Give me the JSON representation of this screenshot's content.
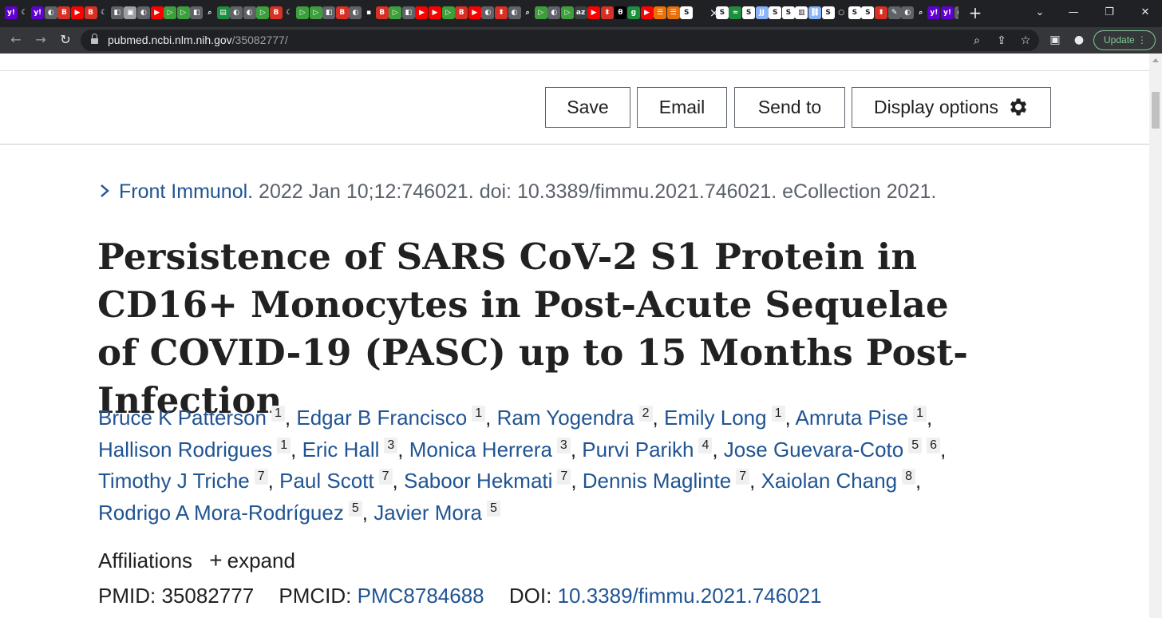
{
  "browser": {
    "url_host": "pubmed.ncbi.nlm.nih.gov",
    "url_path": "/35082777/",
    "update_label": "Update",
    "tab_close": "×",
    "new_tab": "+",
    "tab_favicons": [
      {
        "icon": "yahoo-icon",
        "color": "#6001d2",
        "glyph": "y!"
      },
      {
        "icon": "crescent-icon",
        "color": "#202124",
        "glyph": "☾"
      },
      {
        "icon": "yahoo-icon",
        "color": "#6001d2",
        "glyph": "y!"
      },
      {
        "icon": "globe-icon",
        "color": "#5f6368",
        "glyph": "◐"
      },
      {
        "icon": "bitchute-icon",
        "color": "#d93025",
        "glyph": "B"
      },
      {
        "icon": "youtube-icon",
        "color": "#ff0000",
        "glyph": "▶"
      },
      {
        "icon": "bitchute-icon",
        "color": "#d93025",
        "glyph": "B"
      },
      {
        "icon": "crescent-icon",
        "color": "#202124",
        "glyph": "☾"
      },
      {
        "icon": "doc-icon",
        "color": "#5f6368",
        "glyph": "◧"
      },
      {
        "icon": "image-icon",
        "color": "#9aa0a6",
        "glyph": "▣"
      },
      {
        "icon": "globe-icon",
        "color": "#5f6368",
        "glyph": "◐"
      },
      {
        "icon": "youtube-icon",
        "color": "#ff0000",
        "glyph": "▶"
      },
      {
        "icon": "rumble-icon",
        "color": "#3c9f3c",
        "glyph": "▷"
      },
      {
        "icon": "rumble-icon",
        "color": "#3c9f3c",
        "glyph": "▷"
      },
      {
        "icon": "doc-icon",
        "color": "#5f6368",
        "glyph": "◧"
      },
      {
        "icon": "search-icon",
        "color": "#202124",
        "glyph": "⌕"
      },
      {
        "icon": "notes-icon",
        "color": "#1e8e3e",
        "glyph": "▤"
      },
      {
        "icon": "globe-icon",
        "color": "#5f6368",
        "glyph": "◐"
      },
      {
        "icon": "globe-icon",
        "color": "#5f6368",
        "glyph": "◐"
      },
      {
        "icon": "rumble-icon",
        "color": "#3c9f3c",
        "glyph": "▷"
      },
      {
        "icon": "bitchute-icon",
        "color": "#d93025",
        "glyph": "B"
      },
      {
        "icon": "crescent-icon",
        "color": "#202124",
        "glyph": "☾"
      },
      {
        "icon": "rumble-icon",
        "color": "#3c9f3c",
        "glyph": "▷"
      },
      {
        "icon": "rumble-icon",
        "color": "#3c9f3c",
        "glyph": "▷"
      },
      {
        "icon": "doc-icon",
        "color": "#5f6368",
        "glyph": "◧"
      },
      {
        "icon": "bitchute-icon",
        "color": "#d93025",
        "glyph": "B"
      },
      {
        "icon": "globe-icon",
        "color": "#5f6368",
        "glyph": "◐"
      },
      {
        "icon": "doc-icon",
        "color": "#202124",
        "glyph": "▪"
      },
      {
        "icon": "bitchute-icon",
        "color": "#d93025",
        "glyph": "B"
      },
      {
        "icon": "rumble-icon",
        "color": "#3c9f3c",
        "glyph": "▷"
      },
      {
        "icon": "doc-icon",
        "color": "#5f6368",
        "glyph": "◧"
      },
      {
        "icon": "youtube-icon",
        "color": "#ff0000",
        "glyph": "▶"
      },
      {
        "icon": "youtube-icon",
        "color": "#ff0000",
        "glyph": "▶"
      },
      {
        "icon": "rumble-icon",
        "color": "#3c9f3c",
        "glyph": "▷"
      },
      {
        "icon": "bitchute-icon",
        "color": "#d93025",
        "glyph": "B"
      },
      {
        "icon": "youtube-icon",
        "color": "#ff0000",
        "glyph": "▶"
      },
      {
        "icon": "globe-icon",
        "color": "#5f6368",
        "glyph": "◐"
      },
      {
        "icon": "alert-icon",
        "color": "#d93025",
        "glyph": "⬍"
      },
      {
        "icon": "globe-icon",
        "color": "#5f6368",
        "glyph": "◐"
      },
      {
        "icon": "search-icon",
        "color": "#202124",
        "glyph": "⌕"
      },
      {
        "icon": "rumble-icon",
        "color": "#3c9f3c",
        "glyph": "▷"
      },
      {
        "icon": "globe-icon",
        "color": "#5f6368",
        "glyph": "◐"
      },
      {
        "icon": "rumble-icon",
        "color": "#3c9f3c",
        "glyph": "▷"
      },
      {
        "icon": "text-icon",
        "color": "#3c4043",
        "glyph": "az"
      },
      {
        "icon": "youtube-icon",
        "color": "#ff0000",
        "glyph": "▶"
      },
      {
        "icon": "alert-icon",
        "color": "#d93025",
        "glyph": "⬍"
      },
      {
        "icon": "dark-icon",
        "color": "#000000",
        "glyph": "θ"
      },
      {
        "icon": "g-icon",
        "color": "#1e8e3e",
        "glyph": "g"
      },
      {
        "icon": "youtube-icon",
        "color": "#ff0000",
        "glyph": "▶"
      },
      {
        "icon": "stack-icon",
        "color": "#e8710a",
        "glyph": "☰"
      },
      {
        "icon": "stack-icon",
        "color": "#e8710a",
        "glyph": "☰"
      },
      {
        "icon": "substack-icon",
        "color": "#ffffff",
        "glyph": "S"
      }
    ],
    "tab_favicons_after": [
      {
        "icon": "substack-icon",
        "color": "#ffffff",
        "glyph": "S"
      },
      {
        "icon": "trend-icon",
        "color": "#1e8e3e",
        "glyph": "≈"
      },
      {
        "icon": "substack-icon",
        "color": "#ffffff",
        "glyph": "S"
      },
      {
        "icon": "doc-icon",
        "color": "#8ab4f8",
        "glyph": "JJ"
      },
      {
        "icon": "substack-icon",
        "color": "#ffffff",
        "glyph": "S"
      },
      {
        "icon": "substack-icon",
        "color": "#ffffff",
        "glyph": "S"
      },
      {
        "icon": "doc-icon",
        "color": "#ffffff",
        "glyph": "▥"
      },
      {
        "icon": "link-icon",
        "color": "#8ab4f8",
        "glyph": "⛓"
      },
      {
        "icon": "substack-icon",
        "color": "#ffffff",
        "glyph": "S"
      },
      {
        "icon": "circle-icon",
        "color": "#202124",
        "glyph": "○"
      },
      {
        "icon": "substack-icon",
        "color": "#ffffff",
        "glyph": "S"
      },
      {
        "icon": "substack-icon",
        "color": "#ffffff",
        "glyph": "S"
      },
      {
        "icon": "alert-icon",
        "color": "#d93025",
        "glyph": "⬍"
      },
      {
        "icon": "chart-icon",
        "color": "#5f6368",
        "glyph": "✎"
      },
      {
        "icon": "globe-icon",
        "color": "#5f6368",
        "glyph": "◐"
      },
      {
        "icon": "search-icon",
        "color": "#202124",
        "glyph": "⌕"
      },
      {
        "icon": "yahoo-icon",
        "color": "#6001d2",
        "glyph": "y!"
      },
      {
        "icon": "yahoo-icon",
        "color": "#6001d2",
        "glyph": "y!"
      },
      {
        "icon": "globe-icon",
        "color": "#5f6368",
        "glyph": "◐"
      }
    ]
  },
  "actions": {
    "save": "Save",
    "email": "Email",
    "send_to": "Send to",
    "display_options": "Display options"
  },
  "citation": {
    "journal": "Front Immunol.",
    "details": " 2022 Jan 10;12:746021. doi: 10.3389/fimmu.2021.746021. eCollection 2021."
  },
  "article": {
    "title": "Persistence of SARS CoV-2 S1 Protein in CD16+ Monocytes in Post-Acute Sequelae of COVID-19 (PASC) up to 15 Months Post-Infection",
    "authors": [
      {
        "name": "Bruce K Patterson",
        "affiliations": [
          "1"
        ]
      },
      {
        "name": "Edgar B Francisco",
        "affiliations": [
          "1"
        ]
      },
      {
        "name": "Ram Yogendra",
        "affiliations": [
          "2"
        ]
      },
      {
        "name": "Emily Long",
        "affiliations": [
          "1"
        ]
      },
      {
        "name": "Amruta Pise",
        "affiliations": [
          "1"
        ]
      },
      {
        "name": "Hallison Rodrigues",
        "affiliations": [
          "1"
        ]
      },
      {
        "name": "Eric Hall",
        "affiliations": [
          "3"
        ]
      },
      {
        "name": "Monica Herrera",
        "affiliations": [
          "3"
        ]
      },
      {
        "name": "Purvi Parikh",
        "affiliations": [
          "4"
        ]
      },
      {
        "name": "Jose Guevara-Coto",
        "affiliations": [
          "5",
          "6"
        ]
      },
      {
        "name": "Timothy J Triche",
        "affiliations": [
          "7"
        ]
      },
      {
        "name": "Paul Scott",
        "affiliations": [
          "7"
        ]
      },
      {
        "name": "Saboor Hekmati",
        "affiliations": [
          "7"
        ]
      },
      {
        "name": "Dennis Maglinte",
        "affiliations": [
          "7"
        ]
      },
      {
        "name": "Xaiolan Chang",
        "affiliations": [
          "8"
        ]
      },
      {
        "name": "Rodrigo A Mora-Rodríguez",
        "affiliations": [
          "5"
        ]
      },
      {
        "name": "Javier Mora",
        "affiliations": [
          "5"
        ]
      }
    ],
    "affiliations_label": "Affiliations",
    "expand_label": "expand",
    "pmid_label": "PMID:",
    "pmid": "35082777",
    "pmcid_label": "PMCID:",
    "pmcid": "PMC8784688",
    "doi_label": "DOI:",
    "doi": "10.3389/fimmu.2021.746021"
  },
  "colors": {
    "link": "#205493",
    "text": "#212121",
    "muted": "#5b616b"
  }
}
